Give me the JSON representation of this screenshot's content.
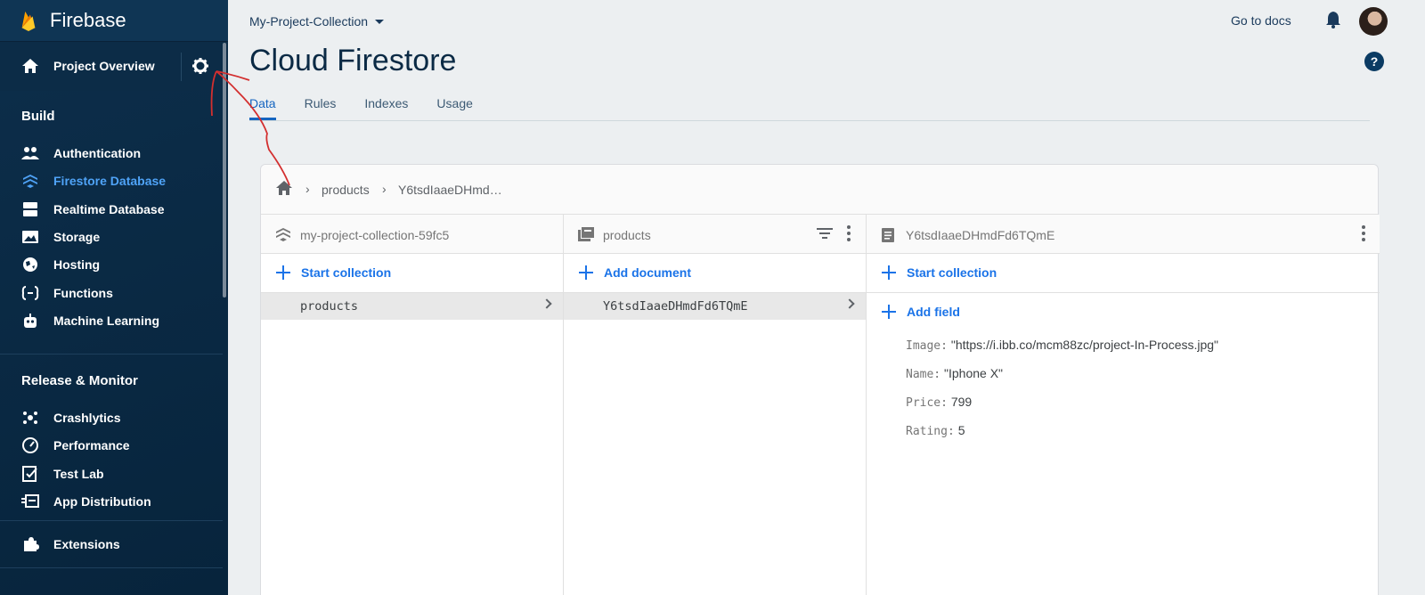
{
  "sidebar": {
    "brand": "Firebase",
    "overview_label": "Project Overview",
    "sections": [
      {
        "title": "Build"
      },
      {
        "title": "Release & Monitor"
      }
    ],
    "build_items": [
      {
        "label": "Authentication"
      },
      {
        "label": "Firestore Database"
      },
      {
        "label": "Realtime Database"
      },
      {
        "label": "Storage"
      },
      {
        "label": "Hosting"
      },
      {
        "label": "Functions"
      },
      {
        "label": "Machine Learning"
      }
    ],
    "release_items": [
      {
        "label": "Crashlytics"
      },
      {
        "label": "Performance"
      },
      {
        "label": "Test Lab"
      },
      {
        "label": "App Distribution"
      }
    ],
    "extensions_label": "Extensions"
  },
  "header": {
    "project": "My-Project-Collection",
    "go_to_docs": "Go to docs",
    "help": "?",
    "page_title": "Cloud Firestore"
  },
  "tabs": [
    {
      "label": "Data",
      "active": true
    },
    {
      "label": "Rules"
    },
    {
      "label": "Indexes"
    },
    {
      "label": "Usage"
    }
  ],
  "breadcrumb": {
    "items": [
      "products",
      "Y6tsdIaaeDHmd…"
    ]
  },
  "columns": {
    "root": {
      "title": "my-project-collection-59fc5",
      "action": "Start collection",
      "selected": "products"
    },
    "collection": {
      "title": "products",
      "action": "Add document",
      "selected": "Y6tsdIaaeDHmdFd6TQmE"
    },
    "document": {
      "title": "Y6tsdIaaeDHmdFd6TQmE",
      "action": "Start collection",
      "add_field": "Add field",
      "fields": [
        {
          "key": "Image:",
          "value": "\"https://i.ibb.co/mcm88zc/project-In-Process.jpg\""
        },
        {
          "key": "Name:",
          "value": "\"Iphone X\""
        },
        {
          "key": "Price:",
          "value": "799"
        },
        {
          "key": "Rating:",
          "value": "5"
        }
      ]
    }
  },
  "colors": {
    "sidebar_bg": "#0b2a45",
    "active_nav": "#4fa3f7",
    "link_blue": "#1a73e8",
    "annotation_red": "#d32f2f"
  }
}
